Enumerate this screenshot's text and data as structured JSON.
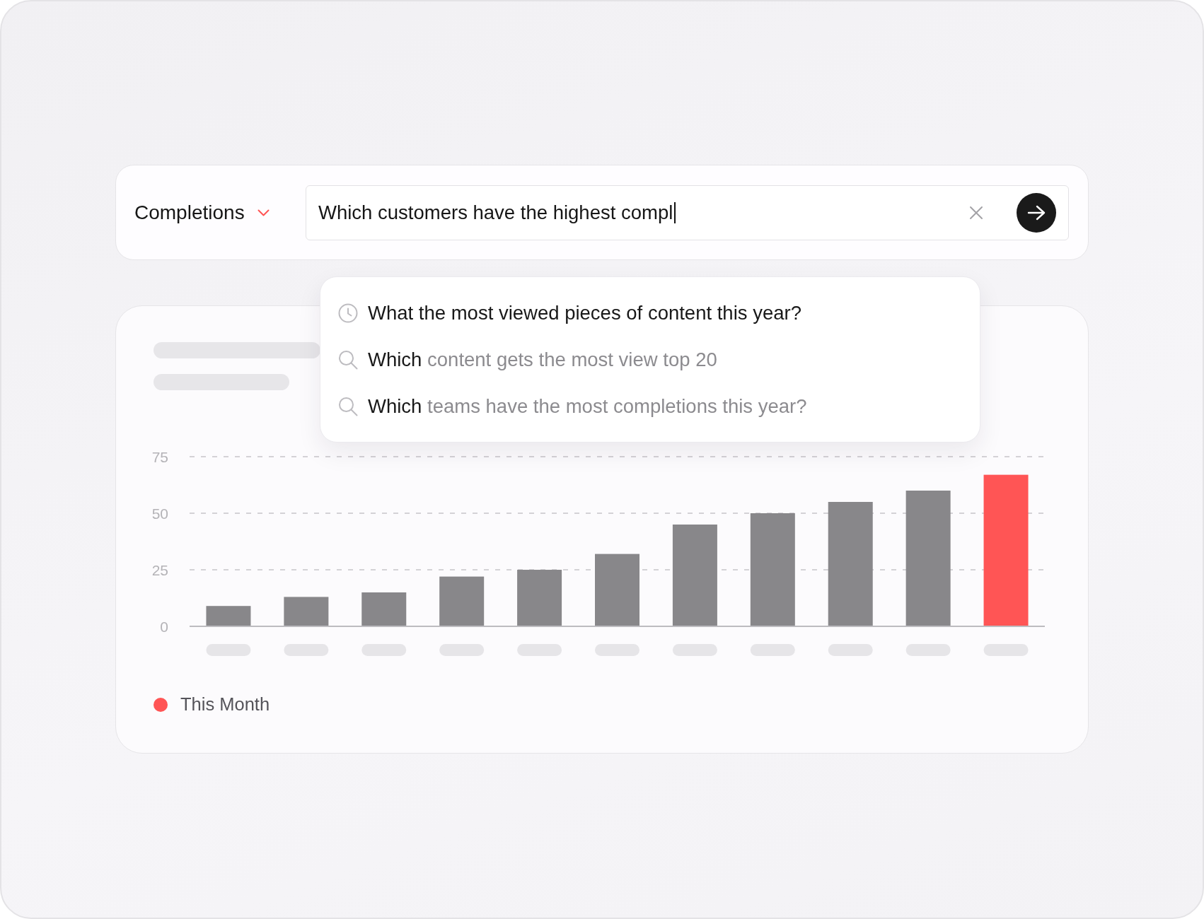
{
  "query_bar": {
    "metric_dropdown": {
      "label": "Completions"
    },
    "search": {
      "value": "Which customers have the highest compl"
    }
  },
  "suggestions": [
    {
      "kind": "recent",
      "text": "What the most viewed pieces of content this year?"
    },
    {
      "kind": "search",
      "text": "Which",
      "completion": "content gets the most view top 20"
    },
    {
      "kind": "search",
      "text": "Which",
      "completion": "teams have the most completions this year?"
    }
  ],
  "chart_card": {
    "chart_data": {
      "type": "bar",
      "values": [
        9,
        13,
        15,
        22,
        25,
        32,
        45,
        50,
        55,
        60,
        67
      ],
      "colors": [
        "#88878a",
        "#88878a",
        "#88878a",
        "#88878a",
        "#88878a",
        "#88878a",
        "#88878a",
        "#88878a",
        "#88878a",
        "#88878a",
        "#ff5555"
      ],
      "ylim": [
        0,
        75
      ],
      "yticks": [
        0,
        25,
        50,
        75
      ]
    },
    "legend": [
      {
        "label": "This Month",
        "color": "#ff5555"
      }
    ]
  }
}
